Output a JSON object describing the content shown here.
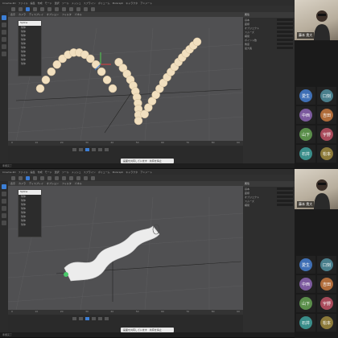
{
  "menu": [
    "Cinema 4D",
    "ファイル",
    "編集",
    "作成",
    "モード",
    "選択",
    "ツール",
    "メッシュ",
    "スプライン",
    "ボリューム",
    "MoGraph",
    "キャラクタ",
    "アニメート",
    "シミュレート",
    "トラッカー",
    "レンダリング",
    "拡張機能",
    "ウインドウ",
    "ヘルプ"
  ],
  "viewport_menu": [
    "表示",
    "カメラ",
    "ディスプレイ",
    "オプション",
    "フィルタ",
    "パネル"
  ],
  "outliner": {
    "header": "Spline",
    "rows": [
      "球体",
      "球体",
      "球体",
      "球体",
      "球体",
      "球体",
      "球体",
      "球体",
      "球体",
      "球体"
    ]
  },
  "timeline_ticks": [
    "0",
    "10",
    "20",
    "30",
    "40",
    "50",
    "60",
    "70",
    "80",
    "90"
  ],
  "attributes": {
    "header": "属性",
    "rows": [
      "基本",
      "座標",
      "オブジェクト",
      "スムーズ",
      "補間",
      "ポイント数",
      "角度",
      "最大長"
    ]
  },
  "status_text": "準備完了",
  "share_bar": {
    "label": "画面を共有しています",
    "stop": "共有を停止"
  },
  "presenter_name": "藤本 貴大",
  "participants": [
    {
      "label": "愛生",
      "color": "#3f6fb5"
    },
    {
      "label": "口刻",
      "color": "#4a7f8c"
    },
    {
      "label": "中西",
      "color": "#7c5a9e"
    },
    {
      "label": "吉田",
      "color": "#b06c3a"
    },
    {
      "label": "山下",
      "color": "#5a8e4a"
    },
    {
      "label": "宇野",
      "color": "#a84a5a"
    },
    {
      "label": "石井",
      "color": "#3a8e8a"
    },
    {
      "label": "松本",
      "color": "#8c7a3a"
    }
  ]
}
